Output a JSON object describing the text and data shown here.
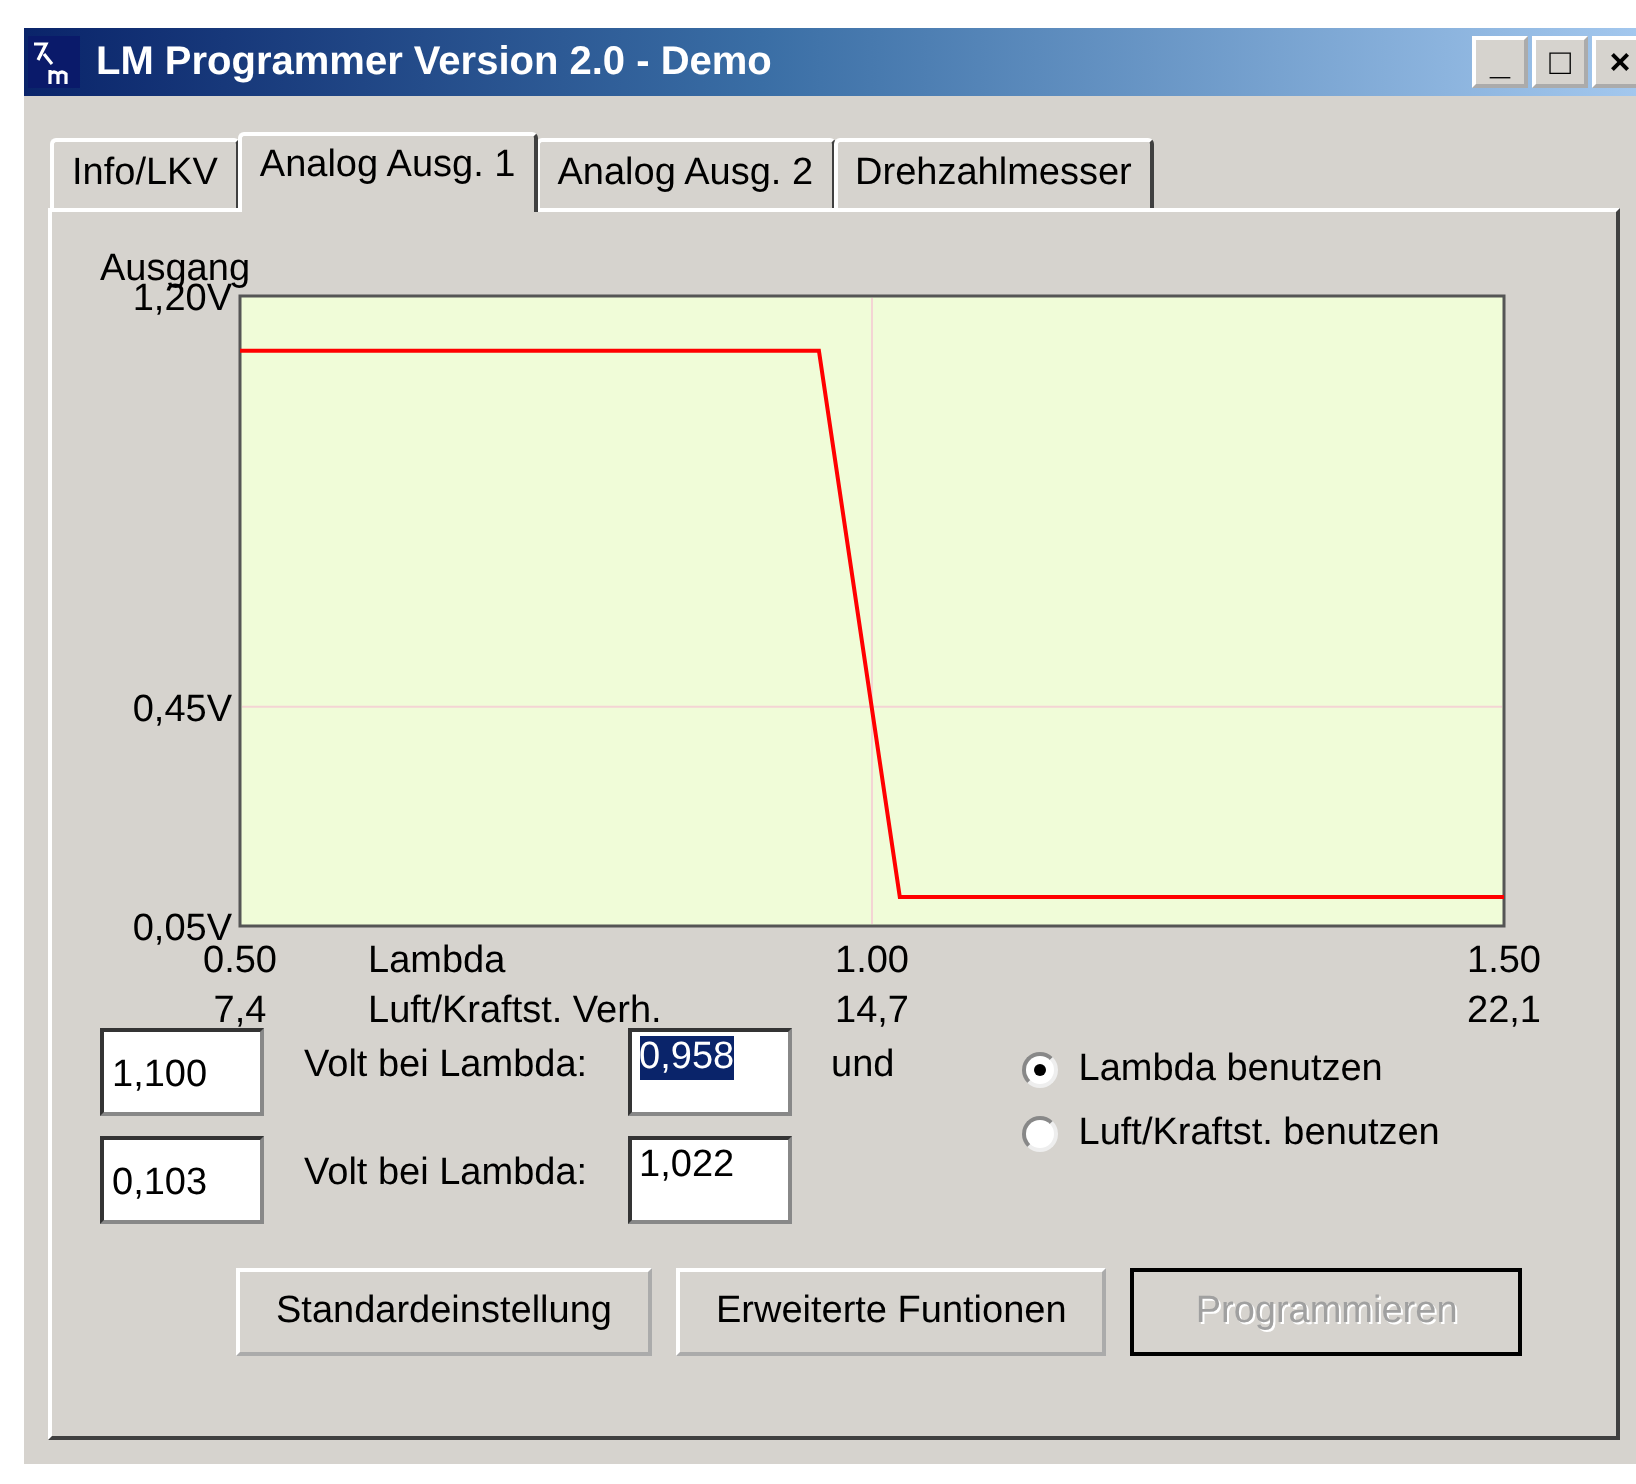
{
  "window": {
    "title": "LM Programmer Version 2.0 - Demo",
    "controls": [
      "_",
      "□",
      "×"
    ]
  },
  "tabs": [
    {
      "label": "Info/LKV",
      "selected": false
    },
    {
      "label": "Analog Ausg. 1",
      "selected": true
    },
    {
      "label": "Analog Ausg. 2",
      "selected": false
    },
    {
      "label": "Drehzahlmesser",
      "selected": false
    }
  ],
  "chart": {
    "chart_data": {
      "type": "line",
      "ylabel": "Ausgang",
      "xlabel": "Lambda",
      "x": [
        0.5,
        0.958,
        1.022,
        1.5
      ],
      "series": [
        {
          "color": "#ff0000",
          "values": [
            1.1,
            1.1,
            0.103,
            0.103
          ]
        }
      ],
      "xlim": [
        0.5,
        1.5
      ],
      "ylim": [
        0.05,
        1.2
      ],
      "xticks": [
        {
          "value": 0.5,
          "label": "0.50"
        },
        {
          "value": 1.0,
          "label": "1.00"
        },
        {
          "value": 1.5,
          "label": "1.50"
        }
      ],
      "yticks": [
        {
          "value": 1.2,
          "label": "1,20V"
        },
        {
          "value": 0.45,
          "label": "0,45V"
        },
        {
          "value": 0.05,
          "label": "0,05V"
        }
      ]
    },
    "secondary_axis": {
      "label": "Luft/Kraftst. Verh.",
      "ticks": [
        "7,4",
        "14,7",
        "22,1"
      ]
    }
  },
  "rows": [
    {
      "volt": "1,100",
      "label": "Volt bei  Lambda:",
      "lambda": "0,958",
      "lambda_selected": true,
      "suffix": "und"
    },
    {
      "volt": "0,103",
      "label": "Volt bei  Lambda:",
      "lambda": "1,022",
      "lambda_selected": false
    }
  ],
  "radios": [
    {
      "label": "Lambda benutzen",
      "selected": true
    },
    {
      "label": "Luft/Kraftst. benutzen",
      "selected": false
    }
  ],
  "buttons": [
    {
      "label": "Standardeinstellung",
      "disabled": false
    },
    {
      "label": "Erweiterte Funtionen",
      "disabled": false
    },
    {
      "label": "Programmieren",
      "disabled": true
    }
  ]
}
